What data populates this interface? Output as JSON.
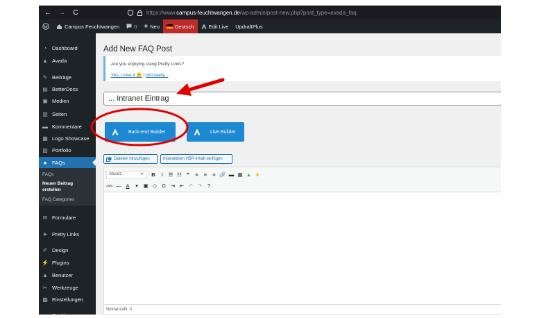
{
  "browser": {
    "back": "←",
    "forward": "→",
    "reload": "C",
    "url_prefix": "https://www.",
    "url_domain": "campus-feuchtwangen.de",
    "url_path": "/wp-admin/post-new.php?post_type=avada_faq"
  },
  "adminbar": {
    "site_name": "Campus Feuchtwangen",
    "comments_count": "0",
    "new_label": "Neu",
    "language": "Deutsch",
    "edit_live": "Edit Live",
    "updraft": "UpdraftPlus"
  },
  "sidebar": {
    "items": [
      {
        "label": "Dashboard",
        "icon": "dashboard-icon"
      },
      {
        "label": "Avada",
        "icon": "avada-icon"
      },
      {
        "label": "Beiträge",
        "icon": "pin-icon"
      },
      {
        "label": "BetterDocs",
        "icon": "docs-icon"
      },
      {
        "label": "Medien",
        "icon": "media-icon"
      },
      {
        "label": "Seiten",
        "icon": "pages-icon"
      },
      {
        "label": "Kommentare",
        "icon": "comments-icon"
      },
      {
        "label": "Logo Showcase",
        "icon": "showcase-icon"
      },
      {
        "label": "Portfolio",
        "icon": "portfolio-icon"
      },
      {
        "label": "FAQs",
        "icon": "info-icon"
      },
      {
        "label": "Formulare",
        "icon": "mail-icon"
      },
      {
        "label": "Pretty Links",
        "icon": "link-icon"
      },
      {
        "label": "Design",
        "icon": "brush-icon"
      },
      {
        "label": "Plugins",
        "icon": "plugin-icon"
      },
      {
        "label": "Benutzer",
        "icon": "user-icon"
      },
      {
        "label": "Werkzeuge",
        "icon": "wrench-icon"
      },
      {
        "label": "Einstellungen",
        "icon": "settings-icon"
      },
      {
        "label": "Cookies",
        "icon": "cookie-icon"
      }
    ],
    "submenu": {
      "faqs": "FAQs",
      "new_post": "Neuen Beitrag erstellen",
      "categories": "FAQ Categories"
    }
  },
  "main": {
    "page_title": "Add New FAQ Post",
    "notice": {
      "question": "Are you enjoying using Pretty Links?",
      "yes": "Yes, I love it 🙂",
      "separator": "|",
      "no": "Not really..."
    },
    "post_title": "... Intranet Eintrag",
    "backend_builder": "Back-end Builder",
    "live_builder": "Live Builder",
    "add_media": "Dateien hinzufügen",
    "add_h5p": "Interaktiven H5P-Inhalt einfügen",
    "format_select": "Absatz",
    "word_count": "Wortanzahl: 0"
  },
  "toolbar_row1": [
    "B",
    "I",
    "☰",
    "☷",
    "❝",
    "≡",
    "≡",
    "≡",
    "🔗",
    "▬",
    "▦",
    "▲",
    "★"
  ],
  "toolbar_row2": [
    "ABC",
    "—",
    "A",
    "▾",
    "▣",
    "◇",
    "Ω",
    "⇥",
    "⇤",
    "↶",
    "↷",
    "?"
  ],
  "colors": {
    "admin_dark": "#1d2327",
    "active_blue": "#2271b1",
    "avada_blue": "#1e89d3",
    "annotation_red": "#e00000",
    "language_red": "#be2a2a"
  }
}
